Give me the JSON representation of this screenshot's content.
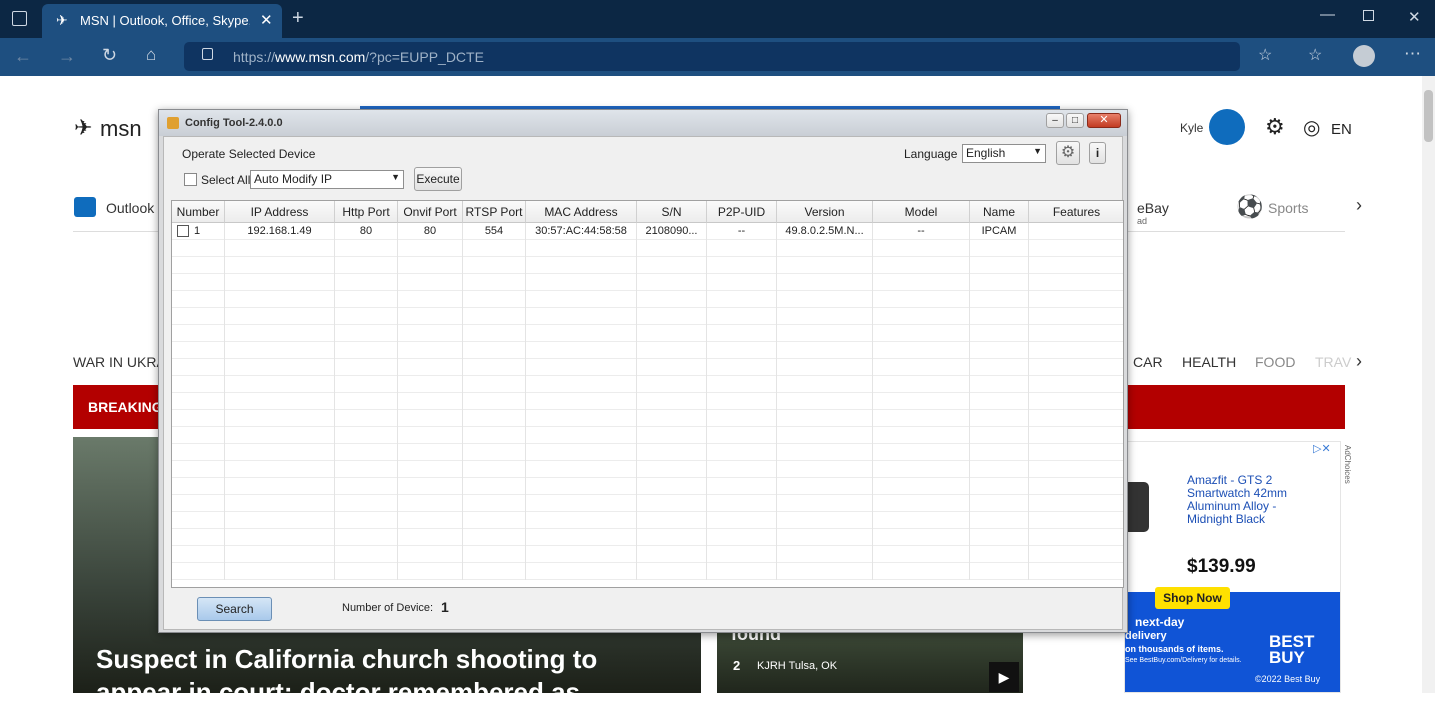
{
  "browser": {
    "tab_title": "MSN | Outlook, Office, Skype, Bi",
    "url_prefix": "https://",
    "url_host": "www.msn.com",
    "url_path": "/?pc=EUPP_DCTE"
  },
  "msn": {
    "logo": "msn",
    "user": "Kyle",
    "lang": "EN",
    "links": [
      "Outlook",
      "eBay",
      "Sports"
    ],
    "ebay_ad": "ad",
    "nav": [
      "WAR IN UKRA",
      "CAR",
      "HEALTH",
      "FOOD",
      "TRAV"
    ],
    "breaking": "BREAKING",
    "headline_line1": "Suspect in California church shooting to",
    "headline_line2": "appear in court; doctor remembered as",
    "mid_text": "found",
    "mid_source": "KJRH Tulsa, OK",
    "ad": {
      "choices": "AdChoices",
      "product": "Amazfit - GTS 2 Smartwatch 42mm Aluminum Alloy - Midnight Black",
      "price": "$139.99",
      "cta": "Shop Now",
      "delivery_line1": "next-day",
      "delivery_line2": "delivery",
      "delivery_line3": "on thousands of items.",
      "delivery_line4": "See BestBuy.com/Delivery for details.",
      "brand1": "BEST",
      "brand2": "BUY",
      "copyright": "©2022 Best Buy"
    }
  },
  "dialog": {
    "title": "Config Tool-2.4.0.0",
    "operate_label": "Operate Selected Device",
    "select_all": "Select All",
    "mode_value": "Auto Modify IP",
    "execute": "Execute",
    "language_label": "Language",
    "language_value": "English",
    "info_btn": "i",
    "columns": [
      "Number",
      "IP Address",
      "Http Port",
      "Onvif Port",
      "RTSP Port",
      "MAC Address",
      "S/N",
      "P2P-UID",
      "Version",
      "Model",
      "Name",
      "Features"
    ],
    "rows": [
      [
        "1",
        "192.168.1.49",
        "80",
        "80",
        "554",
        "30:57:AC:44:58:58",
        "2108090...",
        "--",
        "49.8.0.2.5M.N...",
        "--",
        "IPCAM",
        ""
      ]
    ],
    "search": "Search",
    "count_label": "Number of Device:",
    "count_value": "1"
  }
}
